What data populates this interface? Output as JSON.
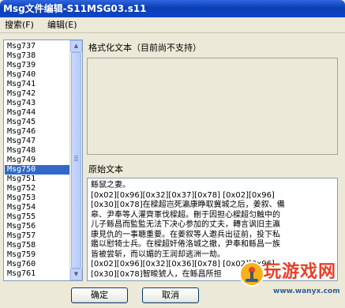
{
  "window": {
    "title": "Msg文件编辑-S11MSG03.s11"
  },
  "menu": {
    "items": [
      {
        "label": "搜索(F)"
      },
      {
        "label": "编辑(E)"
      }
    ]
  },
  "message_list": {
    "items": [
      "Msg737",
      "Msg738",
      "Msg739",
      "Msg740",
      "Msg741",
      "Msg742",
      "Msg743",
      "Msg744",
      "Msg745",
      "Msg746",
      "Msg747",
      "Msg748",
      "Msg749",
      "Msg750",
      "Msg751",
      "Msg752",
      "Msg753",
      "Msg754",
      "Msg755",
      "Msg756",
      "Msg757",
      "Msg758",
      "Msg759",
      "Msg760",
      "Msg761"
    ],
    "selected": "Msg750"
  },
  "formatted_section": {
    "label": "格式化文本（目前尚不支持）"
  },
  "raw_section": {
    "label": "原始文本",
    "lines": [
      "鲧鼠之妻。",
      "[0x02][0x96][0x32][0x37][0x78]    [0x02][0x96]",
      "[0x30][0x78]在樑超岂死瀛康睁取冀城之后，姜叙、備",
      "皋、尹奉等人灌齊軍伐樑超。刪于因担心樑超匀触中的",
      "儿子鲧昌而監監无法下决心参加的丈夫，轉言讽旧主瀛",
      "康見仇的一事聴重要。在姜叙等人邀兵出征前，投下私",
      "鑑以慰犄士兵。在樑超奸倦洛城之撤，尹奉和鲧昌一族",
      "皆被尝斩，而以媚的王润却逃洲一劫。",
      "[0x02][0x96][0x32][0x36][0x78]    [0x02][0x96]",
      "[0x30][0x78]智畯猇人，在鲧昌所担"
    ]
  },
  "buttons": {
    "ok": "确定",
    "cancel": "取消"
  },
  "watermark": {
    "text": "玩游戏网",
    "url": "www.wanyx.com"
  }
}
